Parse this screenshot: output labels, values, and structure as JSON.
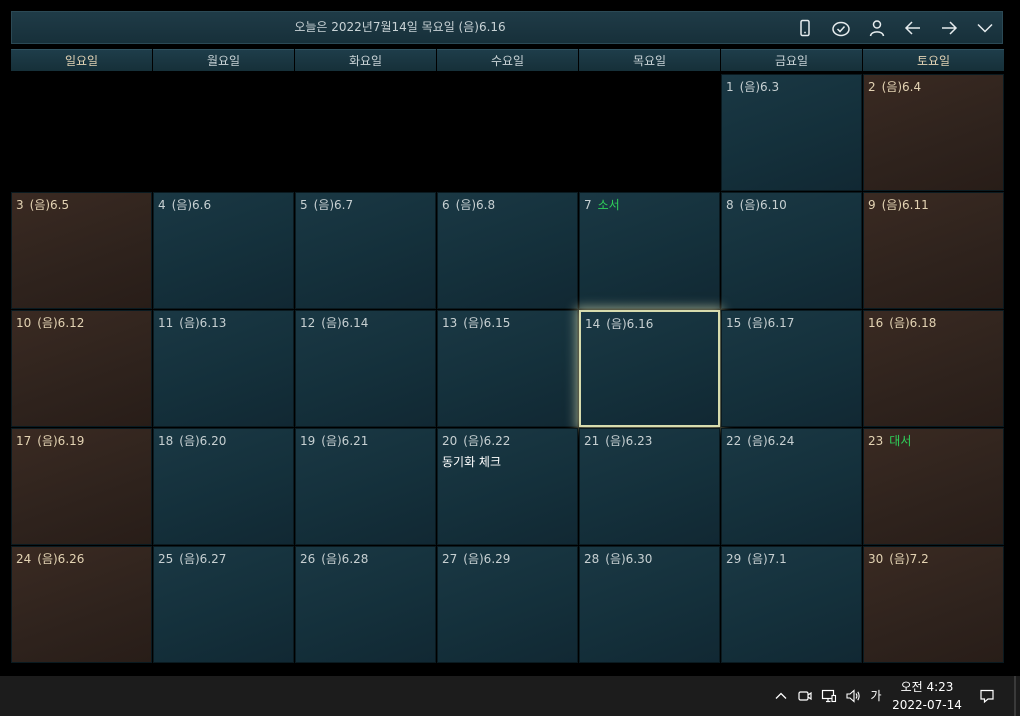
{
  "header": {
    "title": "오늘은 2022년7월14일 목요일 (음)6.16",
    "icons": [
      "phone-icon",
      "sync-check-icon",
      "user-icon",
      "arrow-left-icon",
      "arrow-right-icon",
      "chevron-down-icon"
    ]
  },
  "weekdays": [
    "일요일",
    "월요일",
    "화요일",
    "수요일",
    "목요일",
    "금요일",
    "토요일"
  ],
  "weeks": [
    [
      null,
      null,
      null,
      null,
      null,
      {
        "day": "1",
        "lunar": "(음)6.3"
      },
      {
        "day": "2",
        "lunar": "(음)6.4"
      }
    ],
    [
      {
        "day": "3",
        "lunar": "(음)6.5"
      },
      {
        "day": "4",
        "lunar": "(음)6.6"
      },
      {
        "day": "5",
        "lunar": "(음)6.7"
      },
      {
        "day": "6",
        "lunar": "(음)6.8"
      },
      {
        "day": "7",
        "holiday": "소서"
      },
      {
        "day": "8",
        "lunar": "(음)6.10"
      },
      {
        "day": "9",
        "lunar": "(음)6.11"
      }
    ],
    [
      {
        "day": "10",
        "lunar": "(음)6.12"
      },
      {
        "day": "11",
        "lunar": "(음)6.13"
      },
      {
        "day": "12",
        "lunar": "(음)6.14"
      },
      {
        "day": "13",
        "lunar": "(음)6.15"
      },
      {
        "day": "14",
        "lunar": "(음)6.16",
        "today": true
      },
      {
        "day": "15",
        "lunar": "(음)6.17"
      },
      {
        "day": "16",
        "lunar": "(음)6.18"
      }
    ],
    [
      {
        "day": "17",
        "lunar": "(음)6.19"
      },
      {
        "day": "18",
        "lunar": "(음)6.20"
      },
      {
        "day": "19",
        "lunar": "(음)6.21"
      },
      {
        "day": "20",
        "lunar": "(음)6.22",
        "event": "동기화 체크"
      },
      {
        "day": "21",
        "lunar": "(음)6.23"
      },
      {
        "day": "22",
        "lunar": "(음)6.24"
      },
      {
        "day": "23",
        "holiday": "대서"
      }
    ],
    [
      {
        "day": "24",
        "lunar": "(음)6.26"
      },
      {
        "day": "25",
        "lunar": "(음)6.27"
      },
      {
        "day": "26",
        "lunar": "(음)6.28"
      },
      {
        "day": "27",
        "lunar": "(음)6.29"
      },
      {
        "day": "28",
        "lunar": "(음)6.30"
      },
      {
        "day": "29",
        "lunar": "(음)7.1"
      },
      {
        "day": "30",
        "lunar": "(음)7.2"
      }
    ]
  ],
  "colors": {
    "weekday_cell": "#14303b",
    "weekend_cell": "#2f231d",
    "holiday_text": "#2fd15a",
    "today_border": "#d7dcae"
  },
  "taskbar": {
    "ime": "가",
    "time": "오전 4:23",
    "date": "2022-07-14",
    "tray_icons": [
      "chevron-up-icon",
      "meet-now-icon",
      "network-icon",
      "volume-icon"
    ],
    "notification_icon": "notification-icon"
  }
}
